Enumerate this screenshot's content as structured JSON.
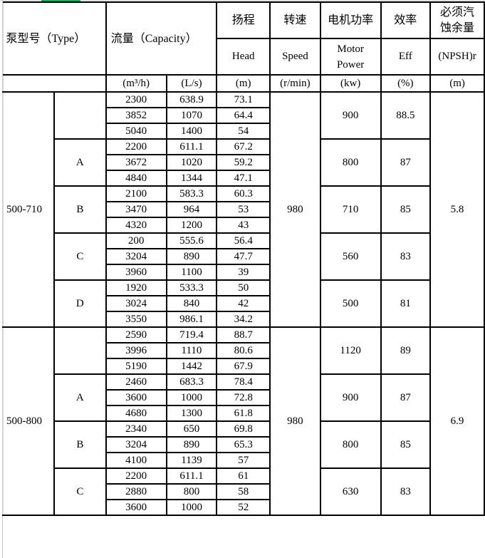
{
  "header": {
    "type_label": "泵型号（Type）",
    "capacity_label": "流量（Capacity）",
    "head_cn": "扬程",
    "head_en": "Head",
    "speed_cn": "转速",
    "speed_en": "Speed",
    "power_cn": "电机功率",
    "power_en": "Motor Power",
    "eff_cn": "效率",
    "eff_en": "Eff",
    "npsh_cn": "必须汽蚀余量",
    "npsh_en": "(NPSH)r",
    "units": {
      "flow_m3h": "(m³/h)",
      "flow_ls": "(L/s)",
      "head": "(m)",
      "speed": "(r/min)",
      "power": "(kw)",
      "eff": "(%)",
      "npsh": "(m)"
    }
  },
  "models": [
    {
      "model": "500-710",
      "speed": "980",
      "npsh": "5.8",
      "variants": [
        {
          "variant": "",
          "power": "900",
          "eff": "88.5",
          "rows": [
            [
              "2300",
              "638.9",
              "73.1"
            ],
            [
              "3852",
              "1070",
              "64.4"
            ],
            [
              "5040",
              "1400",
              "54"
            ]
          ]
        },
        {
          "variant": "A",
          "power": "800",
          "eff": "87",
          "rows": [
            [
              "2200",
              "611.1",
              "67.2"
            ],
            [
              "3672",
              "1020",
              "59.2"
            ],
            [
              "4840",
              "1344",
              "47.1"
            ]
          ]
        },
        {
          "variant": "B",
          "power": "710",
          "eff": "85",
          "rows": [
            [
              "2100",
              "583.3",
              "60.3"
            ],
            [
              "3470",
              "964",
              "53"
            ],
            [
              "4320",
              "1200",
              "43"
            ]
          ]
        },
        {
          "variant": "C",
          "power": "560",
          "eff": "83",
          "rows": [
            [
              "200",
              "555.6",
              "56.4"
            ],
            [
              "3204",
              "890",
              "47.7"
            ],
            [
              "3960",
              "1100",
              "39"
            ]
          ]
        },
        {
          "variant": "D",
          "power": "500",
          "eff": "81",
          "rows": [
            [
              "1920",
              "533.3",
              "50"
            ],
            [
              "3024",
              "840",
              "42"
            ],
            [
              "3550",
              "986.1",
              "34.2"
            ]
          ]
        }
      ]
    },
    {
      "model": "500-800",
      "speed": "980",
      "npsh": "6.9",
      "variants": [
        {
          "variant": "",
          "power": "1120",
          "eff": "89",
          "rows": [
            [
              "2590",
              "719.4",
              "88.7"
            ],
            [
              "3996",
              "1110",
              "80.6"
            ],
            [
              "5190",
              "1442",
              "67.9"
            ]
          ]
        },
        {
          "variant": "A",
          "power": "900",
          "eff": "87",
          "rows": [
            [
              "2460",
              "683.3",
              "78.4"
            ],
            [
              "3600",
              "1000",
              "72.8"
            ],
            [
              "4680",
              "1300",
              "61.8"
            ]
          ]
        },
        {
          "variant": "B",
          "power": "800",
          "eff": "85",
          "rows": [
            [
              "2340",
              "650",
              "69.8"
            ],
            [
              "3204",
              "890",
              "65.3"
            ],
            [
              "4100",
              "1139",
              "57"
            ]
          ]
        },
        {
          "variant": "C",
          "power": "630",
          "eff": "83",
          "rows": [
            [
              "2200",
              "611.1",
              "61"
            ],
            [
              "2880",
              "800",
              "58"
            ],
            [
              "3600",
              "1000",
              "52"
            ]
          ]
        }
      ]
    }
  ]
}
